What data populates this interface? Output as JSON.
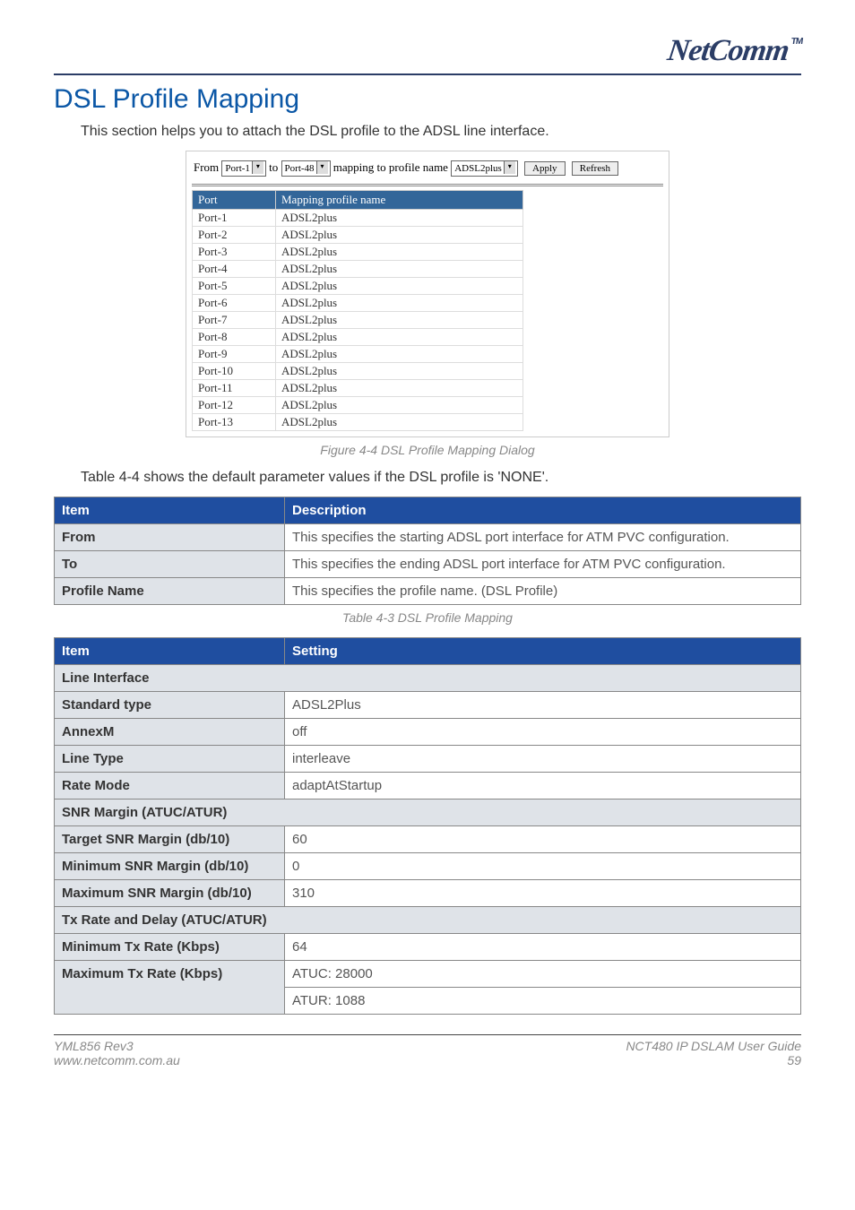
{
  "header": {
    "logo": "NetComm",
    "tm": "TM"
  },
  "title": "DSL Profile Mapping",
  "intro": "This section helps you to attach the DSL profile to the ADSL line interface.",
  "dialog": {
    "labels": {
      "from": "From",
      "to": "to",
      "mapping": "mapping to profile name"
    },
    "from_select": "Port-1",
    "to_select": "Port-48",
    "profile_select": "ADSL2plus",
    "apply_btn": "Apply",
    "refresh_btn": "Refresh",
    "table": {
      "head_port": "Port",
      "head_profile": "Mapping profile name",
      "rows": [
        {
          "port": "Port-1",
          "profile": "ADSL2plus"
        },
        {
          "port": "Port-2",
          "profile": "ADSL2plus"
        },
        {
          "port": "Port-3",
          "profile": "ADSL2plus"
        },
        {
          "port": "Port-4",
          "profile": "ADSL2plus"
        },
        {
          "port": "Port-5",
          "profile": "ADSL2plus"
        },
        {
          "port": "Port-6",
          "profile": "ADSL2plus"
        },
        {
          "port": "Port-7",
          "profile": "ADSL2plus"
        },
        {
          "port": "Port-8",
          "profile": "ADSL2plus"
        },
        {
          "port": "Port-9",
          "profile": "ADSL2plus"
        },
        {
          "port": "Port-10",
          "profile": "ADSL2plus"
        },
        {
          "port": "Port-11",
          "profile": "ADSL2plus"
        },
        {
          "port": "Port-12",
          "profile": "ADSL2plus"
        },
        {
          "port": "Port-13",
          "profile": "ADSL2plus"
        }
      ]
    }
  },
  "figure_caption": "Figure 4-4 DSL Profile Mapping Dialog",
  "paragraph2": "Table 4-4 shows the default parameter values if the DSL profile is 'NONE'.",
  "table43": {
    "head_item": "Item",
    "head_desc": "Description",
    "rows": [
      {
        "item": "From",
        "desc": "This specifies the starting ADSL port interface for ATM PVC configuration."
      },
      {
        "item": "To",
        "desc": "This specifies the ending ADSL port interface for ATM PVC configuration."
      },
      {
        "item": "Profile Name",
        "desc": "This specifies the profile name. (DSL Profile)"
      }
    ],
    "caption": "Table 4-3 DSL Profile Mapping"
  },
  "table_settings": {
    "head_item": "Item",
    "head_setting": "Setting",
    "sections": {
      "line_interface": "Line Interface",
      "snr": "SNR Margin (ATUC/ATUR)",
      "txrate": "Tx Rate and Delay (ATUC/ATUR)"
    },
    "rows_line": [
      {
        "item": "Standard type",
        "setting": "ADSL2Plus"
      },
      {
        "item": "AnnexM",
        "setting": "off"
      },
      {
        "item": "Line Type",
        "setting": "interleave"
      },
      {
        "item": "Rate Mode",
        "setting": "adaptAtStartup"
      }
    ],
    "rows_snr": [
      {
        "item": "Target SNR Margin (db/10)",
        "setting": "60"
      },
      {
        "item": "Minimum SNR Margin (db/10)",
        "setting": "0"
      },
      {
        "item": "Maximum SNR Margin (db/10)",
        "setting": "310"
      }
    ],
    "rows_tx": [
      {
        "item": "Minimum Tx Rate (Kbps)",
        "setting": "64"
      },
      {
        "item": "Maximum Tx Rate (Kbps)",
        "setting_line1": "ATUC: 28000",
        "setting_line2": "ATUR: 1088"
      }
    ]
  },
  "footer": {
    "rev": "YML856 Rev3",
    "url": "www.netcomm.com.au",
    "guide": "NCT480 IP DSLAM User Guide",
    "page": "59"
  }
}
